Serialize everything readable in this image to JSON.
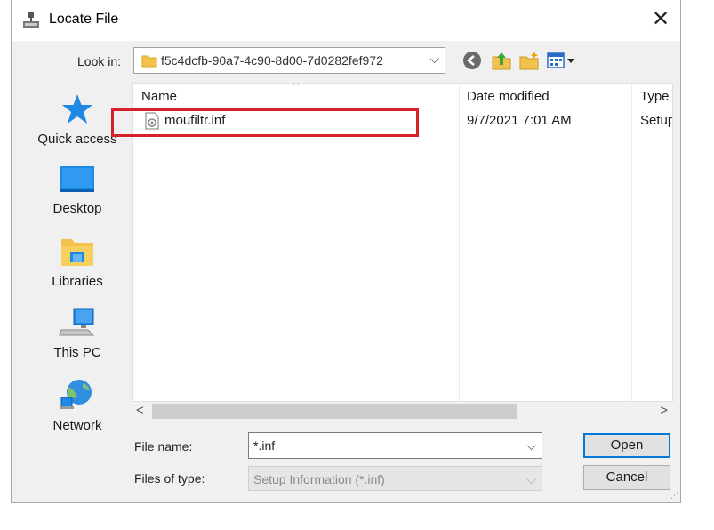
{
  "window": {
    "title": "Locate File",
    "close_glyph": "✕"
  },
  "lookin": {
    "label": "Look in:",
    "value": "f5c4dcfb-90a7-4c90-8d00-7d0282fef972",
    "dropdown_glyph": "⌵"
  },
  "toolbar": {
    "icons": [
      "back-icon",
      "up-folder-icon",
      "new-folder-icon",
      "view-menu-icon"
    ]
  },
  "places": [
    {
      "label": "Quick access",
      "icon": "star-icon"
    },
    {
      "label": "Desktop",
      "icon": "desktop-icon"
    },
    {
      "label": "Libraries",
      "icon": "libraries-icon"
    },
    {
      "label": "This PC",
      "icon": "computer-icon"
    },
    {
      "label": "Network",
      "icon": "network-icon"
    }
  ],
  "filelist": {
    "columns": [
      "Name",
      "Date modified",
      "Type"
    ],
    "sort_glyph": "^",
    "rows": [
      {
        "name": "moufiltr.inf",
        "date": "9/7/2021 7:01 AM",
        "type": "Setup"
      }
    ]
  },
  "scrollbar": {
    "left_glyph": "<",
    "right_glyph": ">"
  },
  "footer": {
    "filename_label": "File name:",
    "filename_value": "*.inf",
    "filetype_label": "Files of type:",
    "filetype_value": "Setup Information (*.inf)",
    "open_label": "Open",
    "cancel_label": "Cancel",
    "dropdown_glyph": "⌵"
  },
  "colors": {
    "highlight_border": "#d8202a",
    "primary_button_border": "#0078d7"
  }
}
